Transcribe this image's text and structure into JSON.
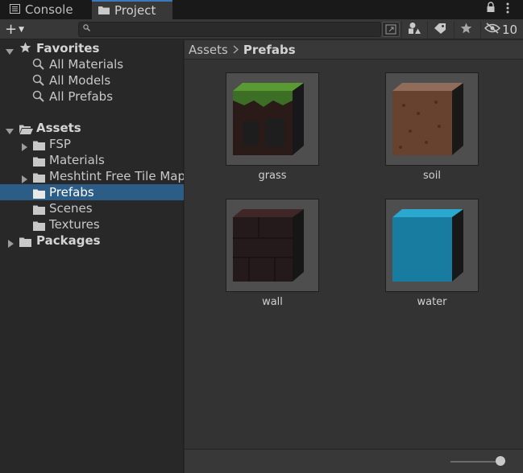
{
  "tabs": [
    {
      "label": "Console",
      "icon": "console-icon"
    },
    {
      "label": "Project",
      "icon": "folder-icon"
    }
  ],
  "toolbar": {
    "create_label": "+",
    "search_placeholder": "",
    "hidden_count": "10"
  },
  "tree": {
    "favorites": {
      "label": "Favorites",
      "items": [
        "All Materials",
        "All Models",
        "All Prefabs"
      ]
    },
    "assets": {
      "label": "Assets",
      "items": [
        {
          "label": "FSP",
          "expandable": true
        },
        {
          "label": "Materials",
          "expandable": false
        },
        {
          "label": "Meshtint Free Tile Map",
          "expandable": true
        },
        {
          "label": "Prefabs",
          "expandable": false,
          "selected": true
        },
        {
          "label": "Scenes",
          "expandable": false
        },
        {
          "label": "Textures",
          "expandable": false
        }
      ]
    },
    "packages": {
      "label": "Packages"
    }
  },
  "breadcrumb": {
    "root": "Assets",
    "current": "Prefabs"
  },
  "assets": [
    {
      "name": "grass",
      "top_color": "#4f8a2d",
      "side_color": "#3a1f16",
      "front_color": "#1d1d1f"
    },
    {
      "name": "soil",
      "top_color": "#9a6a47",
      "side_color": "#7a4b34",
      "front_color": "#1f1f1f"
    },
    {
      "name": "wall",
      "top_color": "#3a2424",
      "side_color": "#2c1c1c",
      "front_color": "#1c1c1c"
    },
    {
      "name": "water",
      "top_color": "#29a7cf",
      "side_color": "#1f8fb8",
      "front_color": "#1a1a1a"
    }
  ],
  "zoom": {
    "value": 1.0
  }
}
